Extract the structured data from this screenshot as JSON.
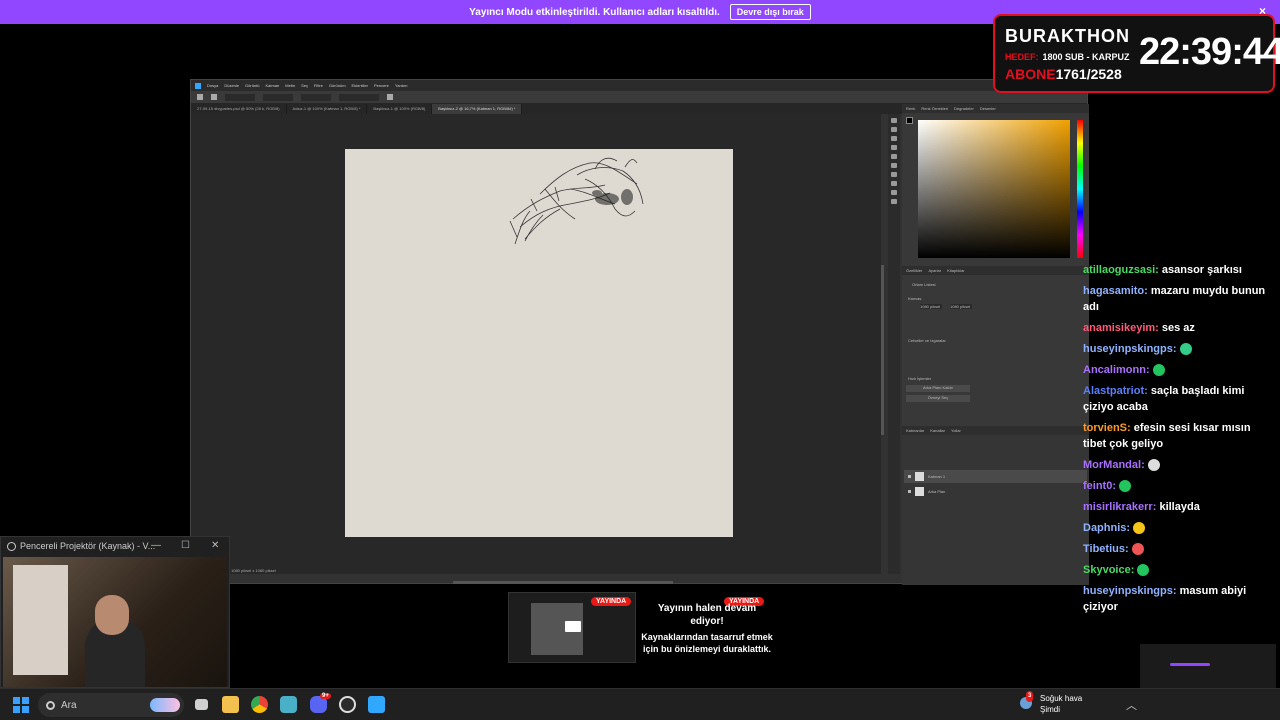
{
  "notice_bar": {
    "message": "Yayıncı Modu etkinleştirildi. Kullanıcı adları kısaltıldı.",
    "button": "Devre dışı bırak",
    "close": "×"
  },
  "photoshop": {
    "menu": [
      "Dosya",
      "Düzenle",
      "Görüntü",
      "Katman",
      "Metin",
      "Seç",
      "Filtre",
      "Görünüm",
      "Eklentiler",
      "Pencere",
      "Yardım"
    ],
    "tabs": [
      {
        "label": "27-09-15 divyparles.psd @ 50% (28 k, RGB/8)",
        "active": false
      },
      {
        "label": "Adsız-1 @ 100% (Katman 1, RGB/8) *",
        "active": false
      },
      {
        "label": "Başlıksız-1 @ 100% (RGB/8)",
        "active": false
      },
      {
        "label": "Başlıksız-2 @ 16,7% (Katman 1, RGB/8#) *",
        "active": true
      }
    ],
    "status": "1080 piksel x 1080 piksel",
    "panel_tabs": [
      "Renk",
      "Renk Örnekleri",
      "Degradeler",
      "Desenler"
    ],
    "prop_tabs": [
      "Özellikler",
      "Ayarlar",
      "Kitaplıklar"
    ],
    "layer_tabs": [
      "Katmanlar",
      "Kanallar",
      "Yollar"
    ],
    "layers": [
      {
        "name": "Katman 1"
      },
      {
        "name": "Arka Plan"
      }
    ],
    "prop_labels": {
      "doc": "Ortam Listesi",
      "canvas": "Kanvas",
      "w": "1080 piksel",
      "h": "1080 piksel",
      "rulers": "Cetveller ve Izgaralar",
      "quick": "Hızlı İşlemler",
      "btn1": "Arka Planı Kaldır",
      "btn2": "Özneyi Seç"
    }
  },
  "overlay": {
    "title": "BURAKTHON",
    "target_label": "HEDEF:",
    "target_text": "1800 SUB - KARPUZ",
    "sub_label": "ABONE",
    "sub_count": "1761/2528",
    "clock": "22:39:44"
  },
  "chat": [
    {
      "user": "atillaoguzsasi",
      "color": "#4cd964",
      "text": "asansor şarkısı"
    },
    {
      "user": "hagasamito",
      "color": "#8fb3ff",
      "text": "mazaru muydu bunun adı"
    },
    {
      "user": "anamisikeyim",
      "color": "#ff5a7a",
      "text": "ses az"
    },
    {
      "user": "huseyinpskingps",
      "color": "#8fb3ff",
      "text": "",
      "emote": "#3c8"
    },
    {
      "user": "Ancalimonn",
      "color": "#a970ff",
      "text": "",
      "emote": "#22c55e"
    },
    {
      "user": "Alastpatriot",
      "color": "#5a7fff",
      "text": "saçla başladı kimi çiziyo acaba"
    },
    {
      "user": "torvienS",
      "color": "#ff9a2a",
      "text": "efesin sesi kısar mısın tibet çok geliyo"
    },
    {
      "user": "MorMandal",
      "color": "#a970ff",
      "text": "",
      "emote": "#ddd"
    },
    {
      "user": "feint0",
      "color": "#a970ff",
      "text": "",
      "emote": "#22c55e"
    },
    {
      "user": "misirlikrakerr",
      "color": "#a970ff",
      "text": "killayda"
    },
    {
      "user": "Daphnis",
      "color": "#8fb3ff",
      "text": "",
      "emote": "#f5c518"
    },
    {
      "user": "Tibetius",
      "color": "#8fb3ff",
      "text": "",
      "emote": "#e55"
    },
    {
      "user": "Skyvoice",
      "color": "#4cd964",
      "text": "",
      "emote": "#22c55e"
    },
    {
      "user": "huseyinpskingps",
      "color": "#8fb3ff",
      "text": "masum abiyi çiziyor"
    }
  ],
  "projector": {
    "title": "Pencereli Projektör (Kaynak) - V..."
  },
  "paused": {
    "badge": "YAYINDA",
    "title": "Yayının halen devam ediyor!",
    "subtitle": "Kaynaklarından tasarruf etmek için bu önizlemeyi duraklattık."
  },
  "taskbar": {
    "search": "Ara",
    "weather_title": "Soğuk hava",
    "weather_sub": "Şimdi",
    "weather_badge": "3",
    "discord_badge": "9+"
  }
}
